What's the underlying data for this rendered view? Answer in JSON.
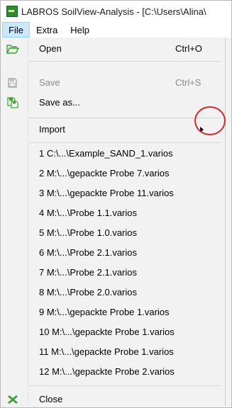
{
  "window": {
    "title": "LABROS SoilView-Analysis - [C:\\Users\\Alina\\"
  },
  "menubar": {
    "items": [
      {
        "label": "File"
      },
      {
        "label": "Extra"
      },
      {
        "label": "Help"
      }
    ]
  },
  "file_menu": {
    "open": {
      "label": "Open",
      "shortcut": "Ctrl+O",
      "icon": "folder-open-icon"
    },
    "save": {
      "label": "Save",
      "shortcut": "Ctrl+S",
      "icon": "floppy-disk-icon",
      "disabled": true
    },
    "save_as": {
      "label": "Save as...",
      "icon": "save-as-icon"
    },
    "import": {
      "label": "Import",
      "has_submenu": true
    },
    "recent_files": [
      "1 C:\\...\\Example_SAND_1.varios",
      "2 M:\\...\\gepackte Probe 7.varios",
      "3 M:\\...\\gepackte Probe 11.varios",
      "4 M:\\...\\Probe 1.1.varios",
      "5 M:\\...\\Probe 1.0.varios",
      "6 M:\\...\\Probe 2.1.varios",
      "7 M:\\...\\Probe 2.1.varios",
      "8 M:\\...\\Probe 2.0.varios",
      "9 M:\\...\\gepackte Probe 1.varios",
      "10 M:\\...\\gepackte Probe 1.varios",
      "11 M:\\...\\gepackte Probe 1.varios",
      "12 M:\\...\\gepackte Probe 2.varios"
    ],
    "close": {
      "label": "Close",
      "icon": "close-x-icon"
    }
  },
  "colors": {
    "menu_bg": "#f2f2f2",
    "menubar_active_bg": "#cce8ff",
    "annotation_circle": "#d0282e",
    "icon_green": "#3f9f3f"
  }
}
